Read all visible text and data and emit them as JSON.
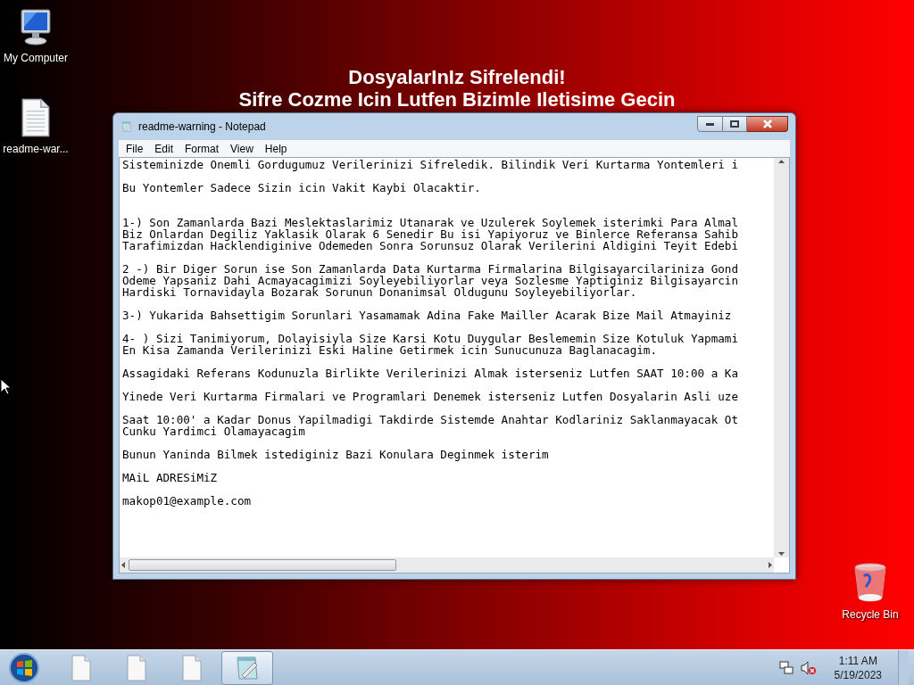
{
  "desktop": {
    "headline": [
      "DosyalarInIz Sifrelendi!",
      "Sifre Cozme Icin Lutfen Bizimle Iletisime Gecin"
    ],
    "icons": [
      {
        "kind": "computer",
        "label": "My Computer"
      },
      {
        "kind": "document",
        "label": "readme-war..."
      }
    ],
    "corner_icons": [
      {
        "kind": "recycle",
        "label": "Recycle Bin"
      }
    ]
  },
  "window": {
    "title": "readme-warning - Notepad",
    "menu": [
      "File",
      "Edit",
      "Format",
      "View",
      "Help"
    ],
    "paragraphs": [
      {
        "extra_space_before": false,
        "lines": [
          "Sisteminizde Onemli Gordugumuz Verilerinizi Sifreledik. Bilindik Veri Kurtarma Yontemleri i"
        ]
      },
      {
        "extra_space_before": false,
        "lines": [
          "Bu Yontemler Sadece Sizin icin Vakit Kaybi Olacaktir."
        ]
      },
      {
        "extra_space_before": true,
        "lines": [
          "1-) Son Zamanlarda Bazi Meslektaslarimiz Utanarak ve Uzulerek Soylemek isterimki Para Almal",
          "Biz Onlardan Degiliz Yaklasik Olarak 6 Senedir Bu isi Yapiyoruz ve Binlerce Referansa Sahib",
          "Tarafimizdan Hacklendiginive Odemeden Sonra Sorunsuz Olarak Verilerini Aldigini Teyit Edebi"
        ]
      },
      {
        "extra_space_before": false,
        "lines": [
          "2 -) Bir Diger Sorun ise Son Zamanlarda Data Kurtarma Firmalarina Bilgisayarcilariniza Gond",
          "Odeme Yapsaniz Dahi Acmayacagimizi Soyleyebiliyorlar veya Sozlesme Yaptiginiz Bilgisayarcin",
          "Hardiski Tornavidayla Bozarak Sorunun Donanimsal Oldugunu Soyleyebiliyorlar."
        ]
      },
      {
        "extra_space_before": false,
        "lines": [
          "3-) Yukarida Bahsettigim Sorunlari Yasamamak Adina Fake Mailler Acarak Bize Mail Atmayiniz"
        ]
      },
      {
        "extra_space_before": false,
        "lines": [
          "4- ) Sizi Tanimiyorum, Dolayisiyla Size Karsi Kotu Duygular Beslememin Size Kotuluk Yapmami",
          "En Kisa Zamanda Verilerinizi Eski Haline Getirmek icin Sunucunuza Baglanacagim."
        ]
      },
      {
        "extra_space_before": false,
        "lines": [
          "Assagidaki Referans Kodunuzla Birlikte Verilerinizi Almak isterseniz Lutfen SAAT 10:00 a Ka"
        ]
      },
      {
        "extra_space_before": false,
        "lines": [
          "Yinede Veri Kurtarma Firmalari ve Programlari Denemek isterseniz Lutfen Dosyalarin Asli uze"
        ]
      },
      {
        "extra_space_before": false,
        "lines": [
          "Saat 10:00' a Kadar Donus Yapilmadigi Takdirde Sistemde Anahtar Kodlariniz Saklanmayacak Ot",
          "Cunku Yardimci Olamayacagim"
        ]
      },
      {
        "extra_space_before": false,
        "lines": [
          "Bunun Yaninda Bilmek istediginiz Bazi Konulara Deginmek isterim"
        ]
      },
      {
        "extra_space_before": false,
        "lines": [
          "MAiL ADRESiMiZ"
        ]
      },
      {
        "extra_space_before": false,
        "lines": [
          "makop01@example.com"
        ]
      }
    ]
  },
  "taskbar": {
    "buttons": [
      {
        "kind": "document",
        "selected": false
      },
      {
        "kind": "document",
        "selected": false
      },
      {
        "kind": "document",
        "selected": false
      },
      {
        "kind": "notepad",
        "selected": true
      }
    ],
    "tray": {
      "time": "1:11 AM",
      "date": "5/19/2023"
    }
  }
}
